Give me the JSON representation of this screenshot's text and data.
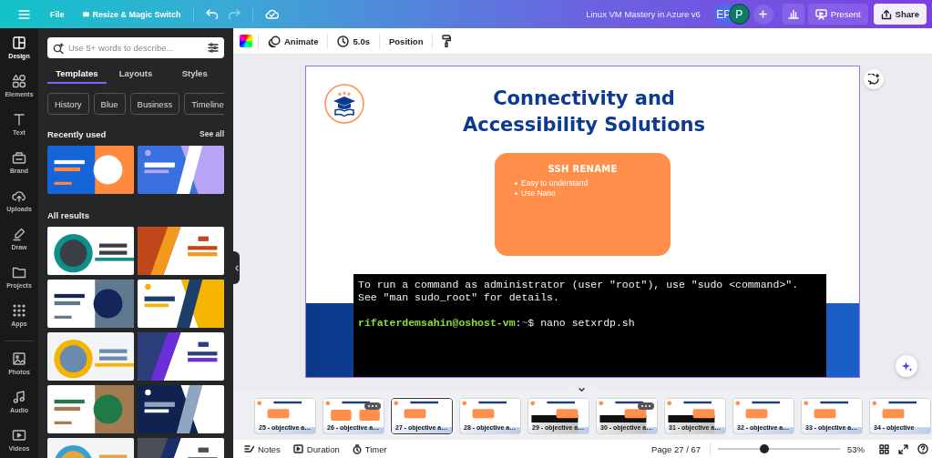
{
  "top_bar": {
    "file": "File",
    "resize": "Resize & Magic Switch",
    "title": "Linux VM Mastery in Azure v6",
    "avatars": [
      {
        "initials": "EP",
        "color": "#4d6af0"
      },
      {
        "initials": "P",
        "color": "#0e7c66"
      }
    ],
    "present": "Present",
    "share": "Share"
  },
  "rail": {
    "groups": [
      [
        {
          "label": "Design",
          "selected": true
        },
        {
          "label": "Elements",
          "selected": false
        },
        {
          "label": "Text",
          "selected": false
        },
        {
          "label": "Brand",
          "selected": false
        },
        {
          "label": "Uploads",
          "selected": false
        },
        {
          "label": "Draw",
          "selected": false
        },
        {
          "label": "Projects",
          "selected": false
        },
        {
          "label": "Apps",
          "selected": false
        }
      ],
      [
        {
          "label": "Photos",
          "selected": false
        },
        {
          "label": "Audio",
          "selected": false
        },
        {
          "label": "Videos",
          "selected": false
        }
      ]
    ]
  },
  "panel": {
    "search": {
      "placeholder": "Use 5+ words to describe..."
    },
    "tabs": [
      {
        "label": "Templates",
        "selected": true
      },
      {
        "label": "Layouts",
        "selected": false
      },
      {
        "label": "Styles",
        "selected": false
      }
    ],
    "chips": [
      "History",
      "Blue",
      "Business",
      "Timeline"
    ],
    "recent": {
      "heading": "Recently used",
      "see_all": "See all"
    },
    "results": {
      "heading": "All results"
    }
  },
  "toolbar": {
    "animate": "Animate",
    "duration": "5.0s",
    "position": "Position"
  },
  "slide": {
    "title": "Connectivity and Accessibility Solutions",
    "card": {
      "heading": "SSH RENAME",
      "bullets": [
        "Easy to understand",
        "Use Nano"
      ]
    },
    "terminal": {
      "lines": [
        "To run a command as administrator (user \"root\"), use \"sudo <command>\".",
        "See \"man sudo_root\" for details."
      ],
      "prompt": {
        "user_host": "rifaterdemsahin@oshost-vm",
        "separator": ":",
        "path": "~",
        "symbol": "$",
        "command": "nano setxrdp.sh"
      }
    }
  },
  "filmstrip": {
    "pages": [
      {
        "label": "25 - objective a…",
        "selected": false,
        "menu_shown": false
      },
      {
        "label": "26 - objective a…",
        "selected": false,
        "menu_shown": true
      },
      {
        "label": "27 - objective a…",
        "selected": true,
        "menu_shown": false
      },
      {
        "label": "28 - objective a…",
        "selected": false,
        "menu_shown": false
      },
      {
        "label": "29 - objective a…",
        "selected": false,
        "menu_shown": false
      },
      {
        "label": "30 - objective a…",
        "selected": false,
        "menu_shown": true
      },
      {
        "label": "31 - objective a…",
        "selected": false,
        "menu_shown": false
      },
      {
        "label": "32 - objective a…",
        "selected": false,
        "menu_shown": false
      },
      {
        "label": "33 - objective a…",
        "selected": false,
        "menu_shown": false
      },
      {
        "label": "34 - objective",
        "selected": false,
        "menu_shown": false
      }
    ]
  },
  "footer": {
    "notes": "Notes",
    "duration": "Duration",
    "timer": "Timer",
    "page": "Page 27 / 67",
    "zoom": {
      "level": 0.38,
      "reading": "53%"
    }
  }
}
